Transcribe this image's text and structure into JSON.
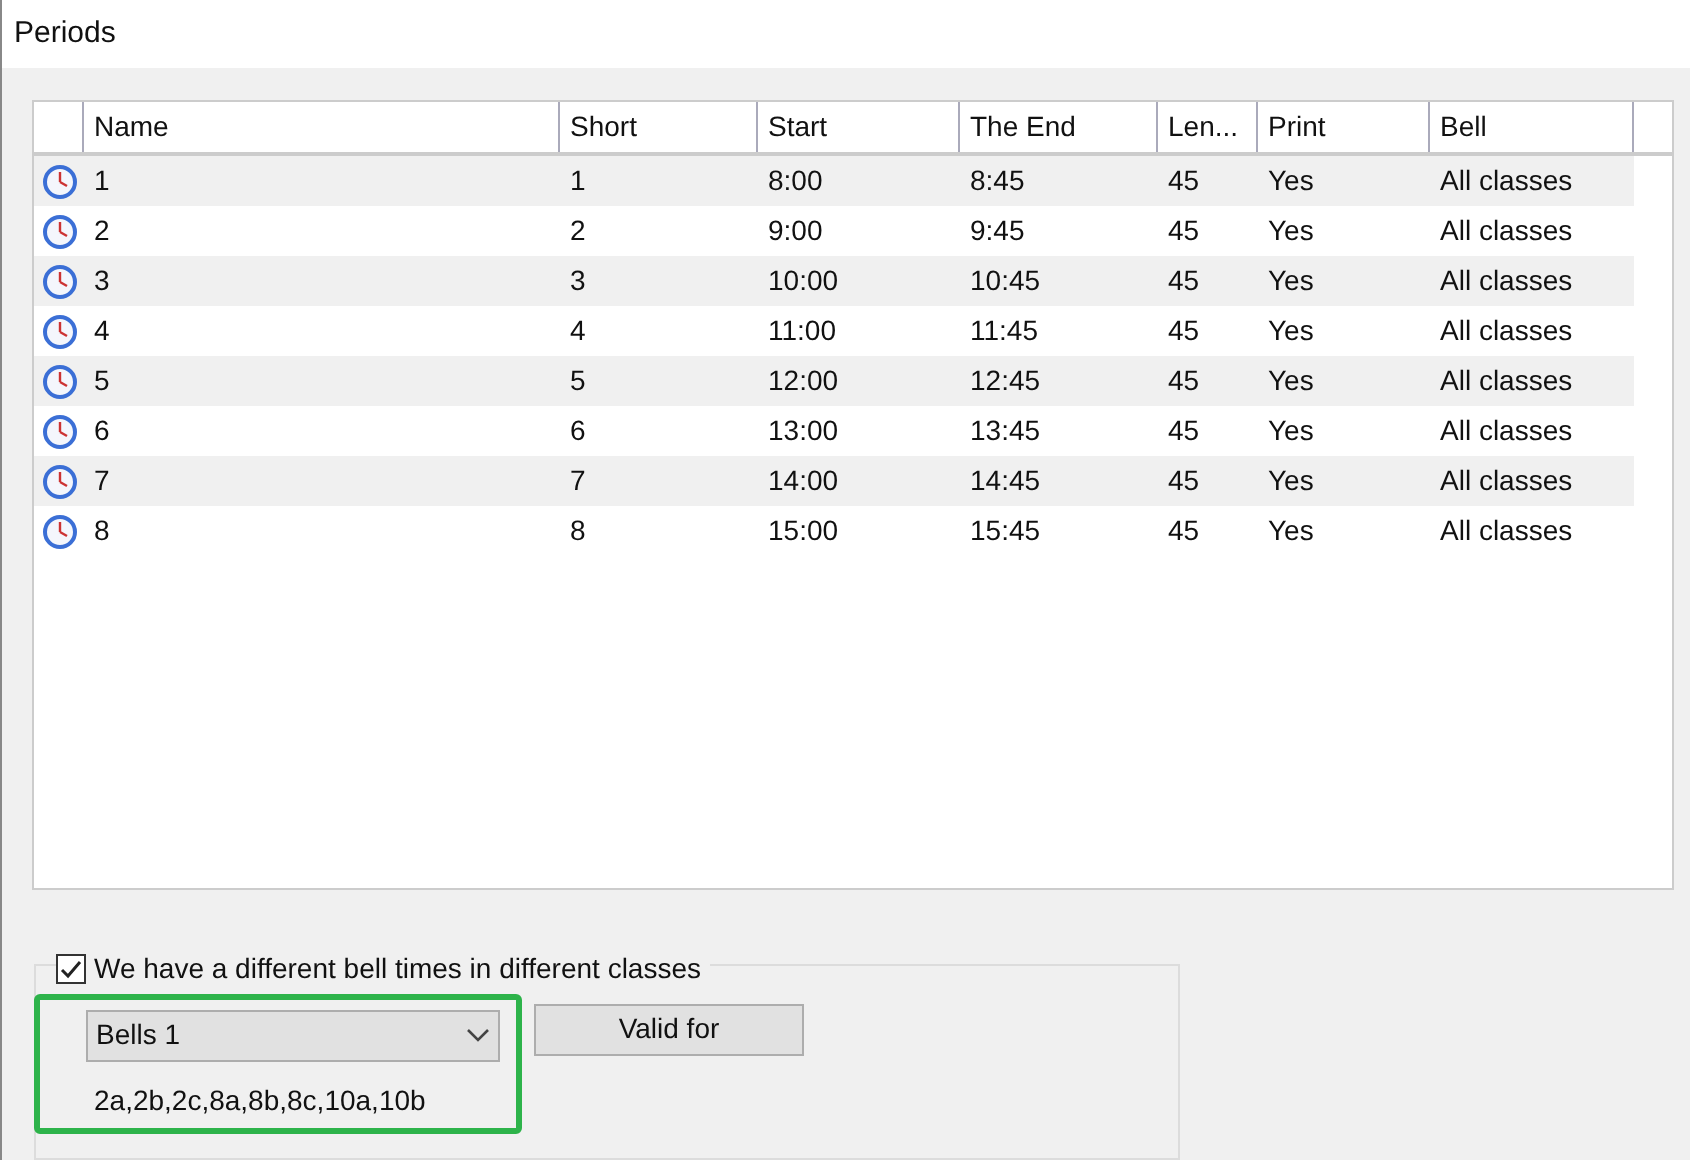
{
  "window": {
    "title": "Periods"
  },
  "table": {
    "columns": [
      "Name",
      "Short",
      "Start",
      "The End",
      "Len...",
      "Print",
      "Bell"
    ],
    "rows": [
      {
        "cells": [
          "1",
          "1",
          "8:00",
          "8:45",
          "45",
          "Yes",
          "All classes"
        ]
      },
      {
        "cells": [
          "2",
          "2",
          "9:00",
          "9:45",
          "45",
          "Yes",
          "All classes"
        ]
      },
      {
        "cells": [
          "3",
          "3",
          "10:00",
          "10:45",
          "45",
          "Yes",
          "All classes"
        ]
      },
      {
        "cells": [
          "4",
          "4",
          "11:00",
          "11:45",
          "45",
          "Yes",
          "All classes"
        ]
      },
      {
        "cells": [
          "5",
          "5",
          "12:00",
          "12:45",
          "45",
          "Yes",
          "All classes"
        ]
      },
      {
        "cells": [
          "6",
          "6",
          "13:00",
          "13:45",
          "45",
          "Yes",
          "All classes"
        ]
      },
      {
        "cells": [
          "7",
          "7",
          "14:00",
          "14:45",
          "45",
          "Yes",
          "All classes"
        ]
      },
      {
        "cells": [
          "8",
          "8",
          "15:00",
          "15:45",
          "45",
          "Yes",
          "All classes"
        ]
      }
    ]
  },
  "bells": {
    "checkbox": {
      "label": "We have a different bell times in different classes",
      "checked": true
    },
    "dropdown": {
      "value": "Bells 1"
    },
    "button": "Valid for",
    "classes": "2a,2b,2c,8a,8b,8c,10a,10b"
  }
}
